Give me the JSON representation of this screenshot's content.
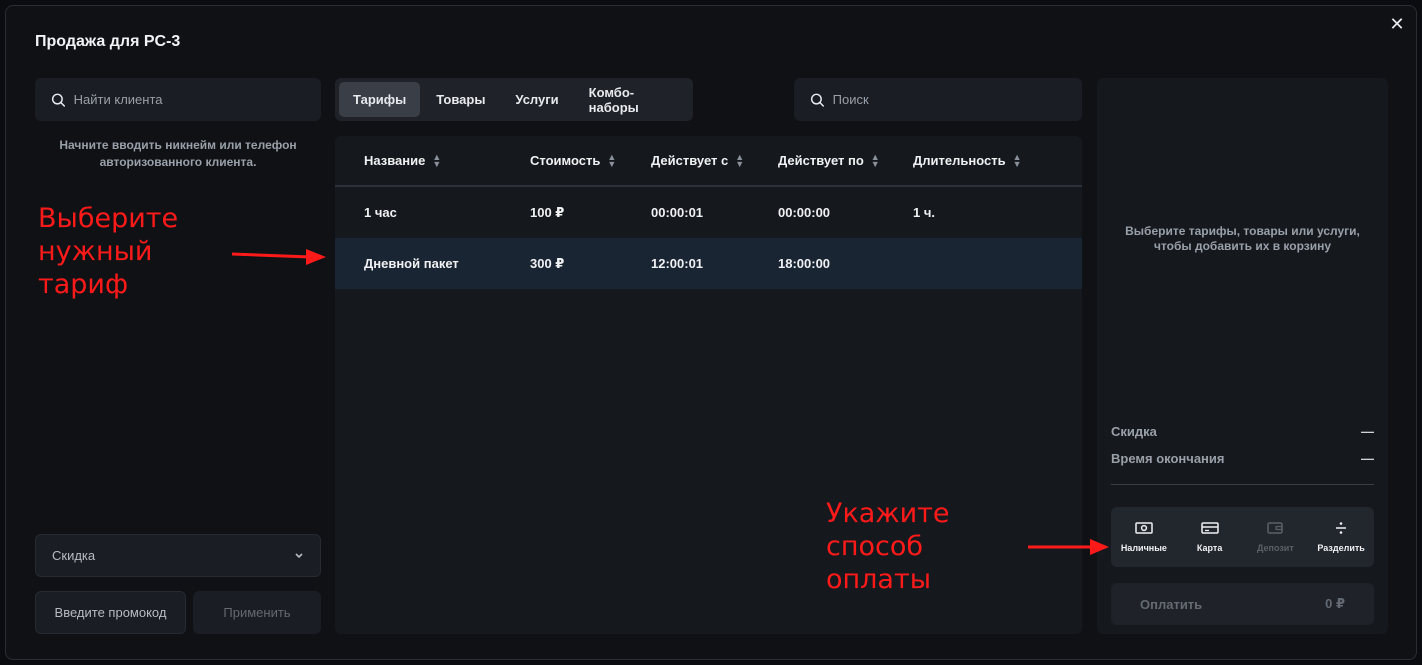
{
  "modal": {
    "title": "Продажа для PC-3",
    "close_label": "✕"
  },
  "client": {
    "search_placeholder": "Найти клиента",
    "hint": "Начните вводить никнейм или телефон авторизованного клиента."
  },
  "discount": {
    "label": "Скидка",
    "promo_placeholder": "Введите промокод",
    "apply_label": "Применить"
  },
  "tabs": [
    {
      "label": "Тарифы",
      "active": true
    },
    {
      "label": "Товары",
      "active": false
    },
    {
      "label": "Услуги",
      "active": false
    },
    {
      "label": "Комбо-наборы",
      "active": false
    }
  ],
  "search": {
    "placeholder": "Поиск"
  },
  "table": {
    "columns": [
      "Название",
      "Стоимость",
      "Действует с",
      "Действует по",
      "Длительность"
    ],
    "rows": [
      {
        "name": "1 час",
        "price": "100 ₽",
        "from": "00:00:01",
        "to": "00:00:00",
        "duration": "1 ч.",
        "selected": false
      },
      {
        "name": "Дневной пакет",
        "price": "300 ₽",
        "from": "12:00:01",
        "to": "18:00:00",
        "duration": "",
        "selected": true
      }
    ]
  },
  "cart": {
    "empty_text": "Выберите тарифы, товары или услуги, чтобы добавить их в корзину",
    "discount_label": "Скидка",
    "discount_value": "—",
    "end_time_label": "Время окончания",
    "end_time_value": "—",
    "payment_methods": [
      {
        "label": "Наличные",
        "icon": "cash-icon",
        "disabled": false
      },
      {
        "label": "Карта",
        "icon": "card-icon",
        "disabled": false
      },
      {
        "label": "Депозит",
        "icon": "wallet-icon",
        "disabled": true
      },
      {
        "label": "Разделить",
        "icon": "divide-icon",
        "disabled": false
      }
    ],
    "pay_label": "Оплатить",
    "pay_amount": "0 ₽"
  },
  "annotations": {
    "select_tariff": "Выберите нужный тариф",
    "payment_method": "Укажите способ оплаты",
    "color": "#ff1a1a"
  }
}
